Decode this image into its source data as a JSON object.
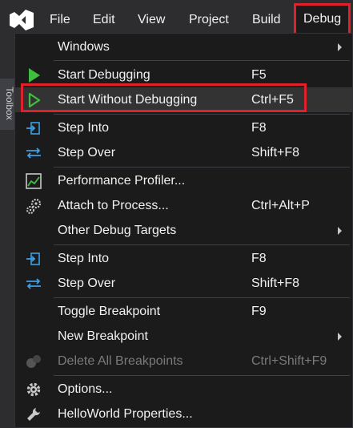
{
  "menubar": {
    "items": [
      "File",
      "Edit",
      "View",
      "Project",
      "Build",
      "Debug"
    ]
  },
  "sidepanel": {
    "toolbox_label": "Toolbox"
  },
  "menu": {
    "items": [
      {
        "label": "Windows",
        "shortcut": "",
        "submenu": true
      },
      {
        "label": "Start Debugging",
        "shortcut": "F5"
      },
      {
        "label": "Start Without Debugging",
        "shortcut": "Ctrl+F5"
      },
      {
        "label": "Step Into",
        "shortcut": "F8"
      },
      {
        "label": "Step Over",
        "shortcut": "Shift+F8"
      },
      {
        "label": "Performance Profiler...",
        "shortcut": ""
      },
      {
        "label": "Attach to Process...",
        "shortcut": "Ctrl+Alt+P"
      },
      {
        "label": "Other Debug Targets",
        "shortcut": "",
        "submenu": true
      },
      {
        "label": "Step Into",
        "shortcut": "F8"
      },
      {
        "label": "Step Over",
        "shortcut": "Shift+F8"
      },
      {
        "label": "Toggle Breakpoint",
        "shortcut": "F9"
      },
      {
        "label": "New Breakpoint",
        "shortcut": "",
        "submenu": true
      },
      {
        "label": "Delete All Breakpoints",
        "shortcut": "Ctrl+Shift+F9",
        "disabled": true
      },
      {
        "label": "Options...",
        "shortcut": ""
      },
      {
        "label": "HelloWorld Properties...",
        "shortcut": ""
      }
    ]
  },
  "colors": {
    "highlight": "#e0202b",
    "play_green": "#3fbf3f",
    "step_blue": "#3e9fe4"
  }
}
